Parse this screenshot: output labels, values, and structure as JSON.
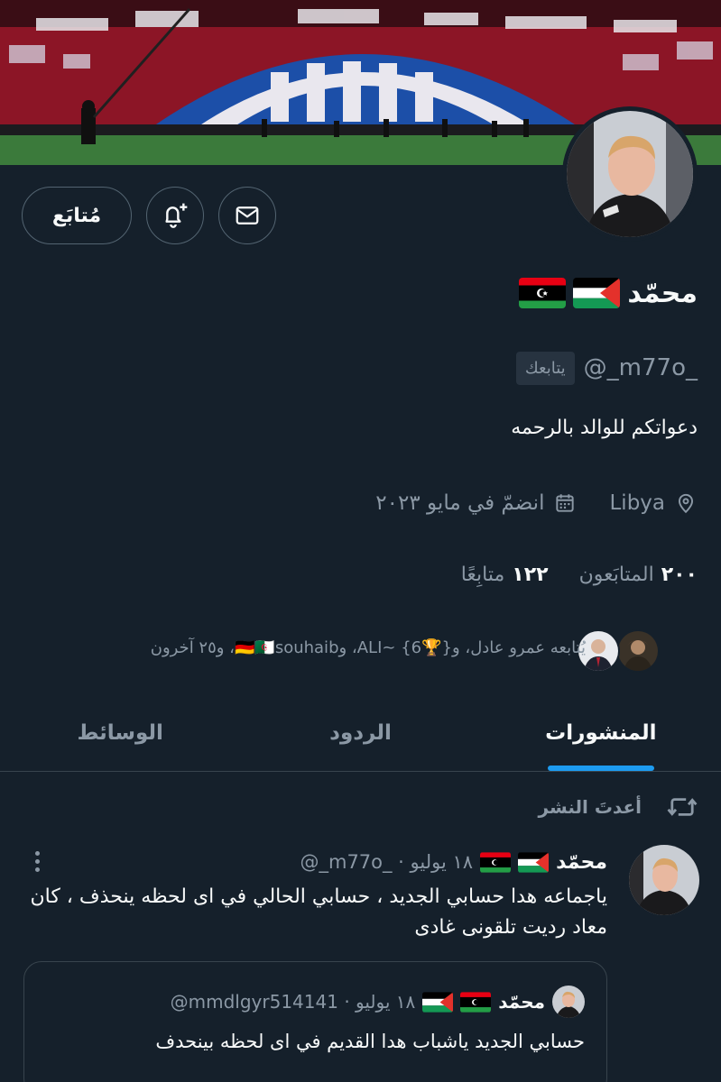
{
  "profile": {
    "name": "محمّد",
    "handle": "@_m77o_",
    "follows_you": "يتابعك",
    "bio": "دعواتكم للوالد بالرحمه",
    "location": "Libya",
    "joined": "انضمّ في مايو ٢٠٢٣",
    "flags": [
      "palestine-flag",
      "libya-flag"
    ]
  },
  "actions": {
    "follow_label": "مُتابَع",
    "bell_icon": "bell-plus-icon",
    "mail_icon": "mail-icon"
  },
  "stats": {
    "followers_count": "٢٠٠",
    "followers_label": "المتابَعون",
    "following_count": "١٢٢",
    "following_label": "متابِعًا"
  },
  "followed_by": {
    "text": "يُتابعه عمرو عادل، و{🏆6} ~ALI، و🇩🇪🇩🇿souhaib، و٢٥ آخرون"
  },
  "tabs": [
    {
      "label": "المنشورات",
      "active": true
    },
    {
      "label": "الردود",
      "active": false
    },
    {
      "label": "الوسائط",
      "active": false
    }
  ],
  "pinned": {
    "label": "أعدتَ النشر",
    "icon": "retweet-icon"
  },
  "post": {
    "author": "محمّد",
    "meta": "@_m77o_ · ١٨ يوليو",
    "text": "ياجماعه هدا حسابي الجديد ، حسابي الحالي في اى لحظه ينحذف ، كان معاد رديت تلقونى غادى"
  },
  "quote": {
    "author": "محمّد",
    "meta": "@mmdlgyr514141 · ١٨ يوليو",
    "text": "حسابي الجديد ياشباب هدا القديم في اى لحظه بينحدف"
  },
  "colors": {
    "background": "#15202b",
    "accent": "#1d9bf0",
    "muted": "#8b98a5",
    "border": "#38444d"
  }
}
